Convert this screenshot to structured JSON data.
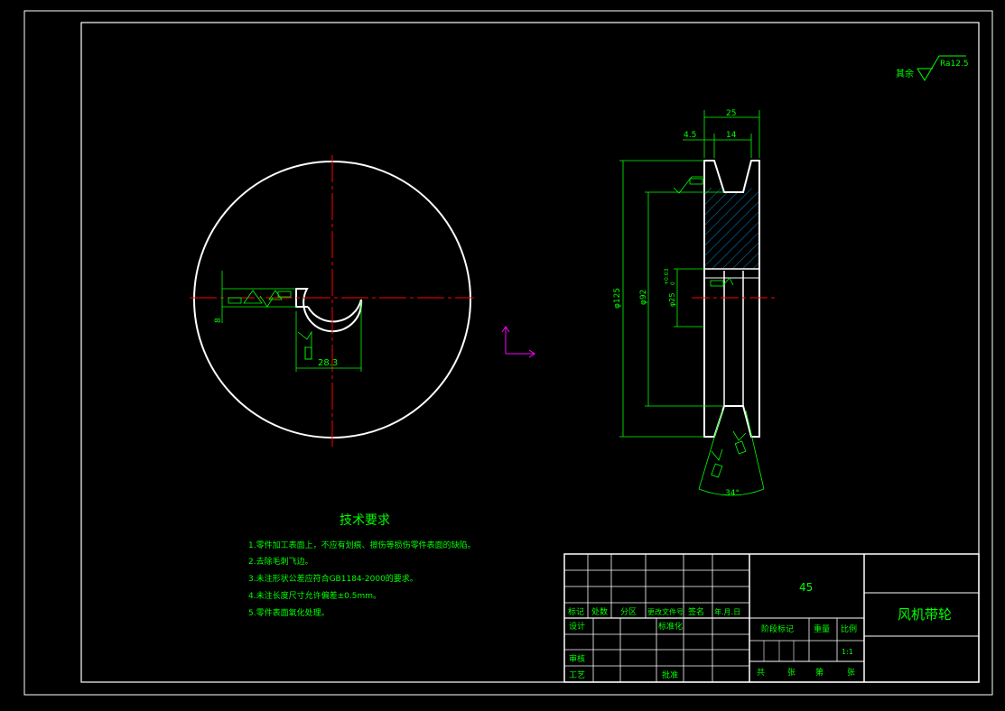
{
  "colors": {
    "background": "#000000",
    "outline": "#ffffff",
    "dimension": "#00ff00",
    "centerline": "#ff0000",
    "hatch": "#00aaff",
    "ucs": "#ff00ff"
  },
  "roughness_note": {
    "prefix": "其余",
    "value": "Ra12.5"
  },
  "front_view": {
    "keyway_width": "8",
    "keyway_depth": "28.3"
  },
  "side_view": {
    "total_width": "25",
    "groove_offset": "4.5",
    "groove_width": "14",
    "outer_diameter": "φ125",
    "groove_bottom_diameter": "φ92",
    "bore_diameter": "φ25",
    "bore_tol_upper": "+0.03",
    "bore_tol_lower": "0",
    "groove_angle": "34°"
  },
  "tech_requirements": {
    "title": "技术要求",
    "items": [
      "1.零件加工表面上，不应有划痕、擦伤等损伤零件表面的缺陷。",
      "2.去除毛刺飞边。",
      "3.未注形状公差应符合GB1184-2000的要求。",
      "4.未注长度尺寸允许偏差±0.5mm。",
      "5.零件表面氧化处理。"
    ]
  },
  "title_block": {
    "material": "45",
    "part_name": "风机带轮",
    "row_labels": [
      "标记",
      "处数",
      "分区",
      "更改文件号",
      "签名",
      "年.月.日"
    ],
    "design": "设计",
    "standardization": "标准化",
    "review": "审核",
    "process": "工艺",
    "approve": "批准",
    "stage_mark": "阶段标记",
    "weight": "重量",
    "scale": "比例",
    "scale_value": "1:1",
    "total_sheets": "共",
    "sheet_unit": "张",
    "sheet_no": "第",
    "sheet_unit2": "张"
  }
}
